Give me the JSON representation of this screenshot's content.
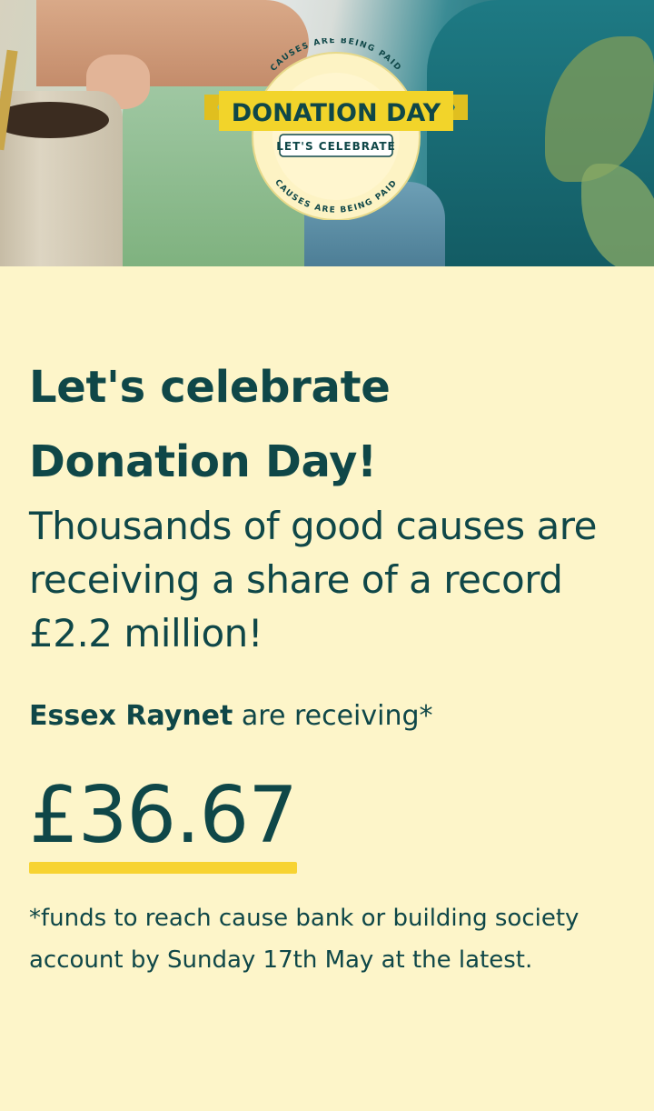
{
  "hero": {
    "badge_title": "DONATION DAY",
    "badge_subtitle": "LET'S CELEBRATE",
    "badge_ring_text": "CAUSES ARE BEING PAID",
    "colors": {
      "ribbon": "#f2d42a",
      "badge_bg": "#fdf3c4",
      "text": "#0f4748"
    }
  },
  "main": {
    "headline_line1": "Let's celebrate",
    "headline_line2": "Donation Day!",
    "lead": "Thousands of good causes are receiving a share of a record £2.2 million!",
    "cause_name": "Essex Raynet",
    "receiving_suffix": " are receiving*",
    "amount": "£36.67",
    "footnote": "*funds to reach cause bank or building society account by Sunday 17th May at the latest."
  },
  "colors": {
    "background": "#fdf5c9",
    "text": "#0f4748",
    "accent_underline": "#f7d332"
  }
}
